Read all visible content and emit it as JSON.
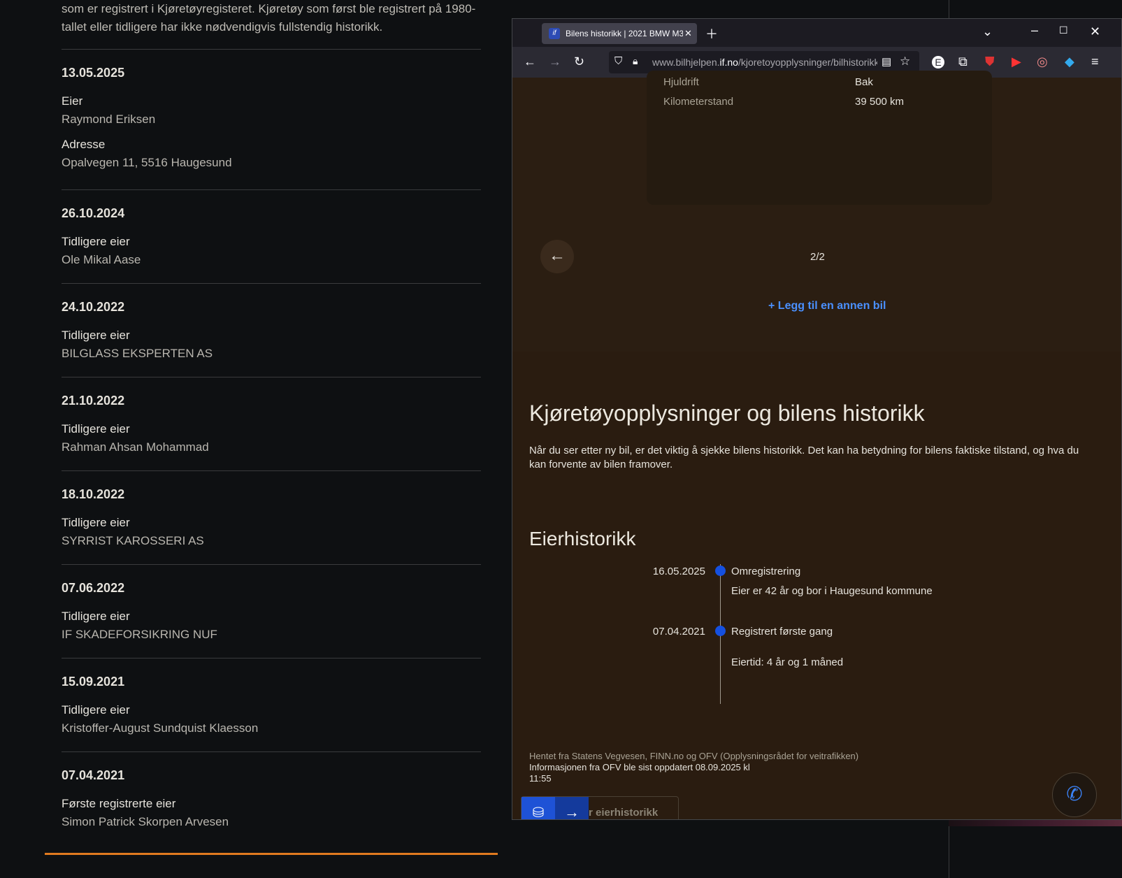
{
  "left": {
    "intro": "som er registrert i Kjøretøyregisteret. Kjøretøy som først ble registrert på 1980-tallet eller tidligere har ikke nødvendigvis fullstendig historikk.",
    "entries": [
      {
        "date": "13.05.2025",
        "fields": [
          {
            "label": "Eier",
            "value": "Raymond Eriksen"
          },
          {
            "label": "Adresse",
            "value": "Opalvegen 11, 5516 Haugesund"
          }
        ]
      },
      {
        "date": "26.10.2024",
        "fields": [
          {
            "label": "Tidligere eier",
            "value": "Ole Mikal Aase"
          }
        ]
      },
      {
        "date": "24.10.2022",
        "fields": [
          {
            "label": "Tidligere eier",
            "value": "BILGLASS EKSPERTEN AS"
          }
        ]
      },
      {
        "date": "21.10.2022",
        "fields": [
          {
            "label": "Tidligere eier",
            "value": "Rahman Ahsan Mohammad"
          }
        ]
      },
      {
        "date": "18.10.2022",
        "fields": [
          {
            "label": "Tidligere eier",
            "value": "SYRRIST KAROSSERI AS"
          }
        ]
      },
      {
        "date": "07.06.2022",
        "fields": [
          {
            "label": "Tidligere eier",
            "value": "IF SKADEFORSIKRING NUF"
          }
        ]
      },
      {
        "date": "15.09.2021",
        "fields": [
          {
            "label": "Tidligere eier",
            "value": "Kristoffer-August Sundquist Klaesson"
          }
        ]
      },
      {
        "date": "07.04.2021",
        "fields": [
          {
            "label": "Første registrerte eier",
            "value": "Simon Patrick Skorpen Arvesen"
          }
        ]
      }
    ]
  },
  "browser": {
    "tab_title": "Bilens historikk | 2021 BMW M3",
    "url_prefix": "www.bilhjelpen.",
    "url_domain": "if.no",
    "url_path": "/kjoretoyopplysninger/bilhistorikk",
    "icons": [
      "back-icon",
      "forward-icon",
      "reload-icon",
      "shield-icon",
      "lock-icon",
      "reader-icon",
      "star-icon",
      "extensions-icon",
      "menu-icon",
      "phone-icon",
      "coins-icon",
      "arrow-right-icon"
    ]
  },
  "page": {
    "specs": [
      {
        "label": "Hjuldrift",
        "value": "Bak"
      },
      {
        "label": "Kilometerstand",
        "value": "39 500 km"
      }
    ],
    "pager": "2/2",
    "add_car": "+ Legg til en annen bil",
    "heading": "Kjøretøyopplysninger og bilens historikk",
    "paragraph": "Når du ser etter ny bil, er det viktig å sjekke bilens historikk. Det kan ha betydning for bilens faktiske tilstand, og hva du kan forvente av bilen framover.",
    "owner_heading": "Eierhistorikk",
    "timeline": [
      {
        "date": "16.05.2025",
        "title": "Omregistrering",
        "desc": "Eier er 42 år og bor i Haugesund kommune"
      },
      {
        "date": "07.04.2021",
        "title": "Registrert første gang",
        "desc": "Eiertid: 4 år og 1 måned"
      }
    ],
    "source": "Hentet fra Statens Vegvesen, FINN.no og OFV (Opplysningsrådet for veitrafikken)",
    "updated": "Informasjonen fra OFV ble sist oppdatert 08.09.2025 kl 11:55",
    "cta": "r eierhistorikk"
  },
  "colors": {
    "accent": "#e07a1f",
    "link": "#4a90ff",
    "primary": "#1e52d6"
  }
}
